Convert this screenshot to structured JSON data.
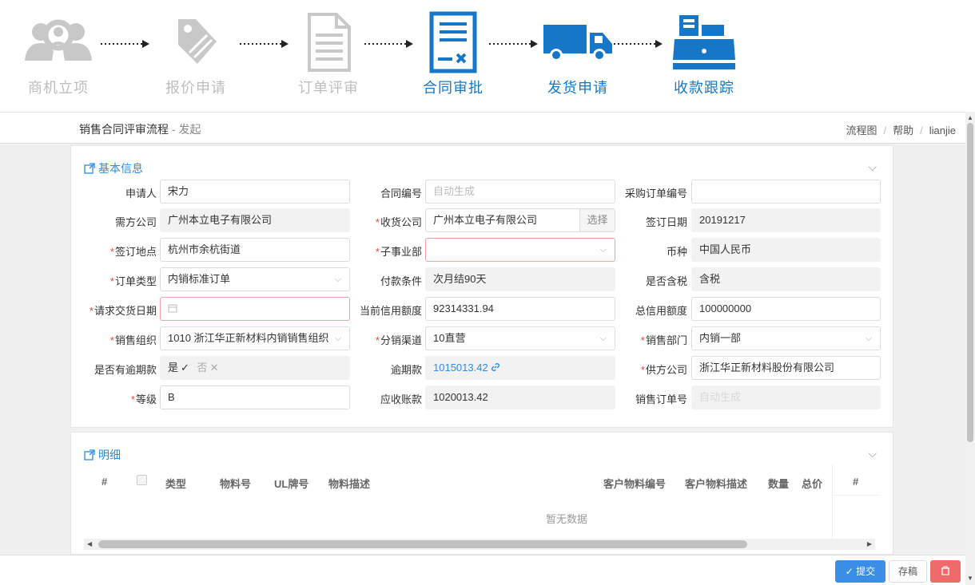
{
  "flow": {
    "steps": [
      {
        "label": "商机立项",
        "state": "done"
      },
      {
        "label": "报价申请",
        "state": "done"
      },
      {
        "label": "订单评审",
        "state": "done"
      },
      {
        "label": "合同审批",
        "state": "active"
      },
      {
        "label": "发货申请",
        "state": "active"
      },
      {
        "label": "收款跟踪",
        "state": "active"
      }
    ],
    "colors": {
      "done": "#c8c8c8",
      "active": "#1677c8"
    }
  },
  "header": {
    "title": "销售合同评审流程",
    "subtitle": " - 发起",
    "crumbs": [
      "流程图",
      "帮助",
      "lianjie"
    ]
  },
  "basic": {
    "title": "基本信息",
    "fields": {
      "applicant": {
        "label": "申请人",
        "value": "宋力"
      },
      "contract_no": {
        "label": "合同编号",
        "placeholder": "自动生成"
      },
      "po_no": {
        "label": "采购订单编号",
        "value": ""
      },
      "buyer": {
        "label": "需方公司",
        "value": "广州本立电子有限公司"
      },
      "receiver": {
        "label": "收货公司",
        "value": "广州本立电子有限公司",
        "button": "选择"
      },
      "sign_date": {
        "label": "签订日期",
        "value": "20191217"
      },
      "sign_place": {
        "label": "签订地点",
        "value": "杭州市余杭街道"
      },
      "division": {
        "label": "子事业部",
        "value": ""
      },
      "currency": {
        "label": "币种",
        "value": "中国人民币"
      },
      "order_type": {
        "label": "订单类型",
        "value": "内销标准订单"
      },
      "pay_terms": {
        "label": "付款条件",
        "value": "次月结90天"
      },
      "tax": {
        "label": "是否含税",
        "value": "含税"
      },
      "delivery_date": {
        "label": "请求交货日期",
        "value": ""
      },
      "credit_now": {
        "label": "当前信用额度",
        "value": "92314331.94"
      },
      "credit_total": {
        "label": "总信用额度",
        "value": "100000000"
      },
      "sales_org": {
        "label": "销售组织",
        "value": "1010 浙江华正新材料内销销售组织"
      },
      "channel": {
        "label": "分销渠道",
        "value": "10直营"
      },
      "sales_dept": {
        "label": "销售部门",
        "value": "内销一部"
      },
      "overdue_flag": {
        "label": "是否有逾期款",
        "yes": "是",
        "no": "否"
      },
      "overdue": {
        "label": "逾期款",
        "value": "1015013.42"
      },
      "supplier": {
        "label": "供方公司",
        "value": "浙江华正新材料股份有限公司"
      },
      "grade": {
        "label": "等级",
        "value": "B"
      },
      "receivable": {
        "label": "应收账款",
        "value": "1020013.42"
      },
      "so_no": {
        "label": "销售订单号",
        "value": "自动生成"
      }
    }
  },
  "detail": {
    "title": "明细",
    "columns": [
      "#",
      "类型",
      "物料号",
      "UL牌号",
      "物料描述",
      "客户物料编号",
      "客户物料描述",
      "数量",
      "总价",
      "#"
    ],
    "empty": "暂无数据"
  },
  "footer": {
    "submit": "提交",
    "draft": "存稿",
    "delete_icon": "trash-icon"
  }
}
